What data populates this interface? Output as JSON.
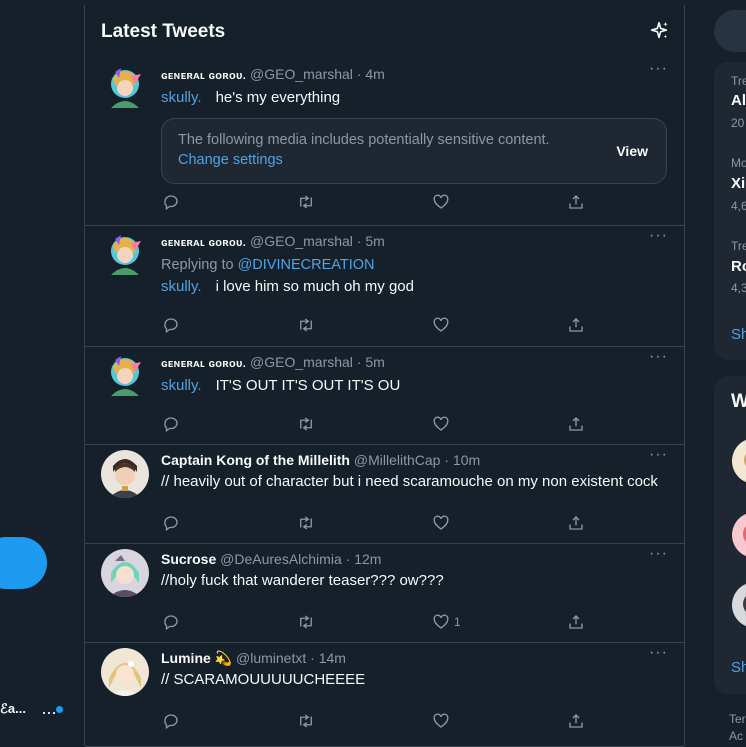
{
  "sidebar": {
    "account_name": "ℰa...",
    "more_glyph": "···"
  },
  "header": {
    "title": "Latest Tweets",
    "sparkle_icon": "sparkle-icon"
  },
  "tweets": [
    {
      "author": "ɢᴇɴᴇʀᴀʟ ɢᴏʀᴏᴜ.",
      "handle": "@GEO_marshal",
      "time": "4m",
      "tag": "skully.",
      "text": "he's my everything",
      "sensitive": {
        "message": "The following media includes potentially sensitive content.",
        "link": "Change settings",
        "action": "View"
      }
    },
    {
      "author": "ɢᴇɴᴇʀᴀʟ ɢᴏʀᴏᴜ.",
      "handle": "@GEO_marshal",
      "time": "5m",
      "replying_prefix": "Replying to",
      "replying_to": "@DIVINECREATION",
      "tag": "skully.",
      "text": "i love him so much oh my god"
    },
    {
      "author": "ɢᴇɴᴇʀᴀʟ ɢᴏʀᴏᴜ.",
      "handle": "@GEO_marshal",
      "time": "5m",
      "tag": "skully.",
      "text": "IT'S OUT IT'S OUT IT'S OU"
    },
    {
      "author": "Captain Kong of the Millelith",
      "handle": "@MillelithCap",
      "time": "10m",
      "text": "// heavily out of character but i need scaramouche on my non existent cock"
    },
    {
      "author": "Sucrose",
      "handle": "@DeAuresAlchimia",
      "time": "12m",
      "text": "//holy fuck that wanderer teaser??? ow???",
      "like_count": "1"
    },
    {
      "author": "Lumine 💫",
      "handle": "@luminetxt",
      "time": "14m",
      "text": "// SCARAMOUUUUUCHEEEE"
    }
  ],
  "dot": "·",
  "more_glyph": "···",
  "right": {
    "trends": [
      {
        "category": "Tre",
        "name": "Al",
        "count": "20"
      },
      {
        "category": "Mo",
        "name": "Xi",
        "count": "4,6"
      },
      {
        "category": "Tre",
        "name": "Ro",
        "count": "4,3"
      }
    ],
    "show_more": "Sh",
    "who_title": "W",
    "who_show_more": "Sh",
    "footer_1": "Ter",
    "footer_2": "Ac"
  },
  "colors": {
    "background": "#15202b",
    "accent": "#1d9bf0",
    "link": "#4fa3e3",
    "muted": "#8b98a5",
    "border": "#38444d"
  }
}
